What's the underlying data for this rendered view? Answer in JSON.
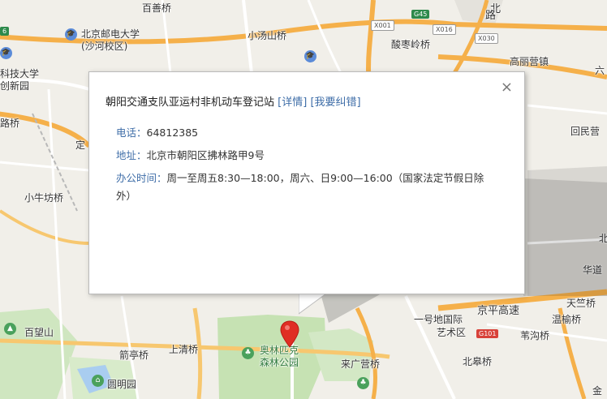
{
  "map": {
    "labels": [
      {
        "text": "百善桥",
        "cls": "lbl"
      },
      {
        "text": "北京邮电大学",
        "cls": "lbl"
      },
      {
        "text": "(沙河校区)",
        "cls": "lbl"
      },
      {
        "text": "小汤山桥",
        "cls": "lbl"
      },
      {
        "text": "酸枣岭桥",
        "cls": "lbl"
      },
      {
        "text": "高丽营镇",
        "cls": "lbl"
      },
      {
        "text": "科技大学",
        "cls": "lbl"
      },
      {
        "text": "创新园",
        "cls": "lbl"
      },
      {
        "text": "路桥",
        "cls": "lbl"
      },
      {
        "text": "定",
        "cls": "lbl"
      },
      {
        "text": "小牛坊桥",
        "cls": "lbl"
      },
      {
        "text": "回民营",
        "cls": "lbl"
      },
      {
        "text": "北",
        "cls": "lbl"
      },
      {
        "text": "华道",
        "cls": "lbl"
      },
      {
        "text": "百望山",
        "cls": "lbl"
      },
      {
        "text": "箭亭桥",
        "cls": "lbl"
      },
      {
        "text": "上清桥",
        "cls": "lbl"
      },
      {
        "text": "奥林匹克",
        "cls": "lbl green"
      },
      {
        "text": "森林公园",
        "cls": "lbl green"
      },
      {
        "text": "圆明园",
        "cls": "lbl"
      },
      {
        "text": "来广营桥",
        "cls": "lbl"
      },
      {
        "text": "一号地国际",
        "cls": "lbl"
      },
      {
        "text": "艺术区",
        "cls": "lbl"
      },
      {
        "text": "京平高速",
        "cls": "lbl big"
      },
      {
        "text": "天竺桥",
        "cls": "lbl"
      },
      {
        "text": "温榆桥",
        "cls": "lbl"
      },
      {
        "text": "苇沟桥",
        "cls": "lbl"
      },
      {
        "text": "北皋桥",
        "cls": "lbl"
      },
      {
        "text": "金",
        "cls": "lbl"
      },
      {
        "text": "北",
        "cls": "lbl big"
      },
      {
        "text": "路",
        "cls": "lbl big"
      },
      {
        "text": "六",
        "cls": "lbl"
      }
    ],
    "shields": [
      {
        "text": "G45",
        "cls": "shield g"
      },
      {
        "text": "X001",
        "cls": "shield w"
      },
      {
        "text": "X016",
        "cls": "shield w"
      },
      {
        "text": "X030",
        "cls": "shield w"
      },
      {
        "text": "G101",
        "cls": "shield r"
      },
      {
        "text": "6",
        "cls": "shield g"
      }
    ]
  },
  "popup": {
    "title": "朝阳交通支队亚运村非机动车登记站",
    "detail_link": "[详情]",
    "report_link": "[我要纠错]",
    "close": "×",
    "phone_label": "电话：",
    "phone": "64812385",
    "address_label": "地址：",
    "address": "北京市朝阳区拂林路甲9号",
    "hours_label": "办公时间：",
    "hours": "周一至周五8:30—18:00，周六、日9:00—16:00（国家法定节假日除外）"
  },
  "colors": {
    "expressway": "#f5b04a",
    "road": "#ffffff",
    "park": "#c9e3b6",
    "water": "#a9cdf0",
    "pin": "#e02e24",
    "link": "#3f6ea8"
  }
}
